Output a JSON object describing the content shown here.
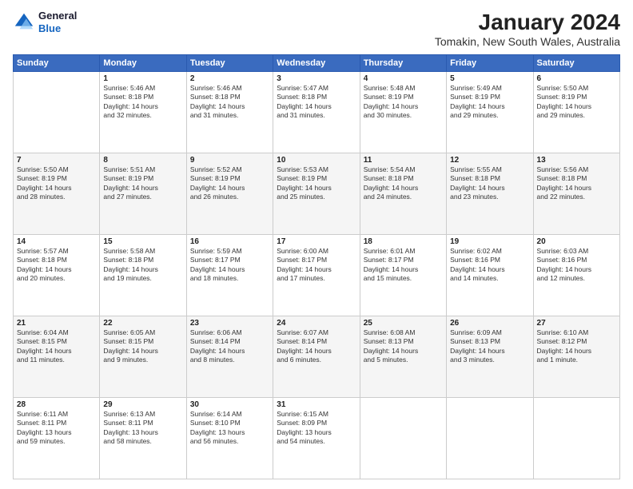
{
  "logo": {
    "line1": "General",
    "line2": "Blue"
  },
  "title": "January 2024",
  "subtitle": "Tomakin, New South Wales, Australia",
  "days_of_week": [
    "Sunday",
    "Monday",
    "Tuesday",
    "Wednesday",
    "Thursday",
    "Friday",
    "Saturday"
  ],
  "weeks": [
    [
      {
        "day": "",
        "info": ""
      },
      {
        "day": "1",
        "info": "Sunrise: 5:46 AM\nSunset: 8:18 PM\nDaylight: 14 hours\nand 32 minutes."
      },
      {
        "day": "2",
        "info": "Sunrise: 5:46 AM\nSunset: 8:18 PM\nDaylight: 14 hours\nand 31 minutes."
      },
      {
        "day": "3",
        "info": "Sunrise: 5:47 AM\nSunset: 8:18 PM\nDaylight: 14 hours\nand 31 minutes."
      },
      {
        "day": "4",
        "info": "Sunrise: 5:48 AM\nSunset: 8:19 PM\nDaylight: 14 hours\nand 30 minutes."
      },
      {
        "day": "5",
        "info": "Sunrise: 5:49 AM\nSunset: 8:19 PM\nDaylight: 14 hours\nand 29 minutes."
      },
      {
        "day": "6",
        "info": "Sunrise: 5:50 AM\nSunset: 8:19 PM\nDaylight: 14 hours\nand 29 minutes."
      }
    ],
    [
      {
        "day": "7",
        "info": "Sunrise: 5:50 AM\nSunset: 8:19 PM\nDaylight: 14 hours\nand 28 minutes."
      },
      {
        "day": "8",
        "info": "Sunrise: 5:51 AM\nSunset: 8:19 PM\nDaylight: 14 hours\nand 27 minutes."
      },
      {
        "day": "9",
        "info": "Sunrise: 5:52 AM\nSunset: 8:19 PM\nDaylight: 14 hours\nand 26 minutes."
      },
      {
        "day": "10",
        "info": "Sunrise: 5:53 AM\nSunset: 8:19 PM\nDaylight: 14 hours\nand 25 minutes."
      },
      {
        "day": "11",
        "info": "Sunrise: 5:54 AM\nSunset: 8:18 PM\nDaylight: 14 hours\nand 24 minutes."
      },
      {
        "day": "12",
        "info": "Sunrise: 5:55 AM\nSunset: 8:18 PM\nDaylight: 14 hours\nand 23 minutes."
      },
      {
        "day": "13",
        "info": "Sunrise: 5:56 AM\nSunset: 8:18 PM\nDaylight: 14 hours\nand 22 minutes."
      }
    ],
    [
      {
        "day": "14",
        "info": "Sunrise: 5:57 AM\nSunset: 8:18 PM\nDaylight: 14 hours\nand 20 minutes."
      },
      {
        "day": "15",
        "info": "Sunrise: 5:58 AM\nSunset: 8:18 PM\nDaylight: 14 hours\nand 19 minutes."
      },
      {
        "day": "16",
        "info": "Sunrise: 5:59 AM\nSunset: 8:17 PM\nDaylight: 14 hours\nand 18 minutes."
      },
      {
        "day": "17",
        "info": "Sunrise: 6:00 AM\nSunset: 8:17 PM\nDaylight: 14 hours\nand 17 minutes."
      },
      {
        "day": "18",
        "info": "Sunrise: 6:01 AM\nSunset: 8:17 PM\nDaylight: 14 hours\nand 15 minutes."
      },
      {
        "day": "19",
        "info": "Sunrise: 6:02 AM\nSunset: 8:16 PM\nDaylight: 14 hours\nand 14 minutes."
      },
      {
        "day": "20",
        "info": "Sunrise: 6:03 AM\nSunset: 8:16 PM\nDaylight: 14 hours\nand 12 minutes."
      }
    ],
    [
      {
        "day": "21",
        "info": "Sunrise: 6:04 AM\nSunset: 8:15 PM\nDaylight: 14 hours\nand 11 minutes."
      },
      {
        "day": "22",
        "info": "Sunrise: 6:05 AM\nSunset: 8:15 PM\nDaylight: 14 hours\nand 9 minutes."
      },
      {
        "day": "23",
        "info": "Sunrise: 6:06 AM\nSunset: 8:14 PM\nDaylight: 14 hours\nand 8 minutes."
      },
      {
        "day": "24",
        "info": "Sunrise: 6:07 AM\nSunset: 8:14 PM\nDaylight: 14 hours\nand 6 minutes."
      },
      {
        "day": "25",
        "info": "Sunrise: 6:08 AM\nSunset: 8:13 PM\nDaylight: 14 hours\nand 5 minutes."
      },
      {
        "day": "26",
        "info": "Sunrise: 6:09 AM\nSunset: 8:13 PM\nDaylight: 14 hours\nand 3 minutes."
      },
      {
        "day": "27",
        "info": "Sunrise: 6:10 AM\nSunset: 8:12 PM\nDaylight: 14 hours\nand 1 minute."
      }
    ],
    [
      {
        "day": "28",
        "info": "Sunrise: 6:11 AM\nSunset: 8:11 PM\nDaylight: 13 hours\nand 59 minutes."
      },
      {
        "day": "29",
        "info": "Sunrise: 6:13 AM\nSunset: 8:11 PM\nDaylight: 13 hours\nand 58 minutes."
      },
      {
        "day": "30",
        "info": "Sunrise: 6:14 AM\nSunset: 8:10 PM\nDaylight: 13 hours\nand 56 minutes."
      },
      {
        "day": "31",
        "info": "Sunrise: 6:15 AM\nSunset: 8:09 PM\nDaylight: 13 hours\nand 54 minutes."
      },
      {
        "day": "",
        "info": ""
      },
      {
        "day": "",
        "info": ""
      },
      {
        "day": "",
        "info": ""
      }
    ]
  ]
}
